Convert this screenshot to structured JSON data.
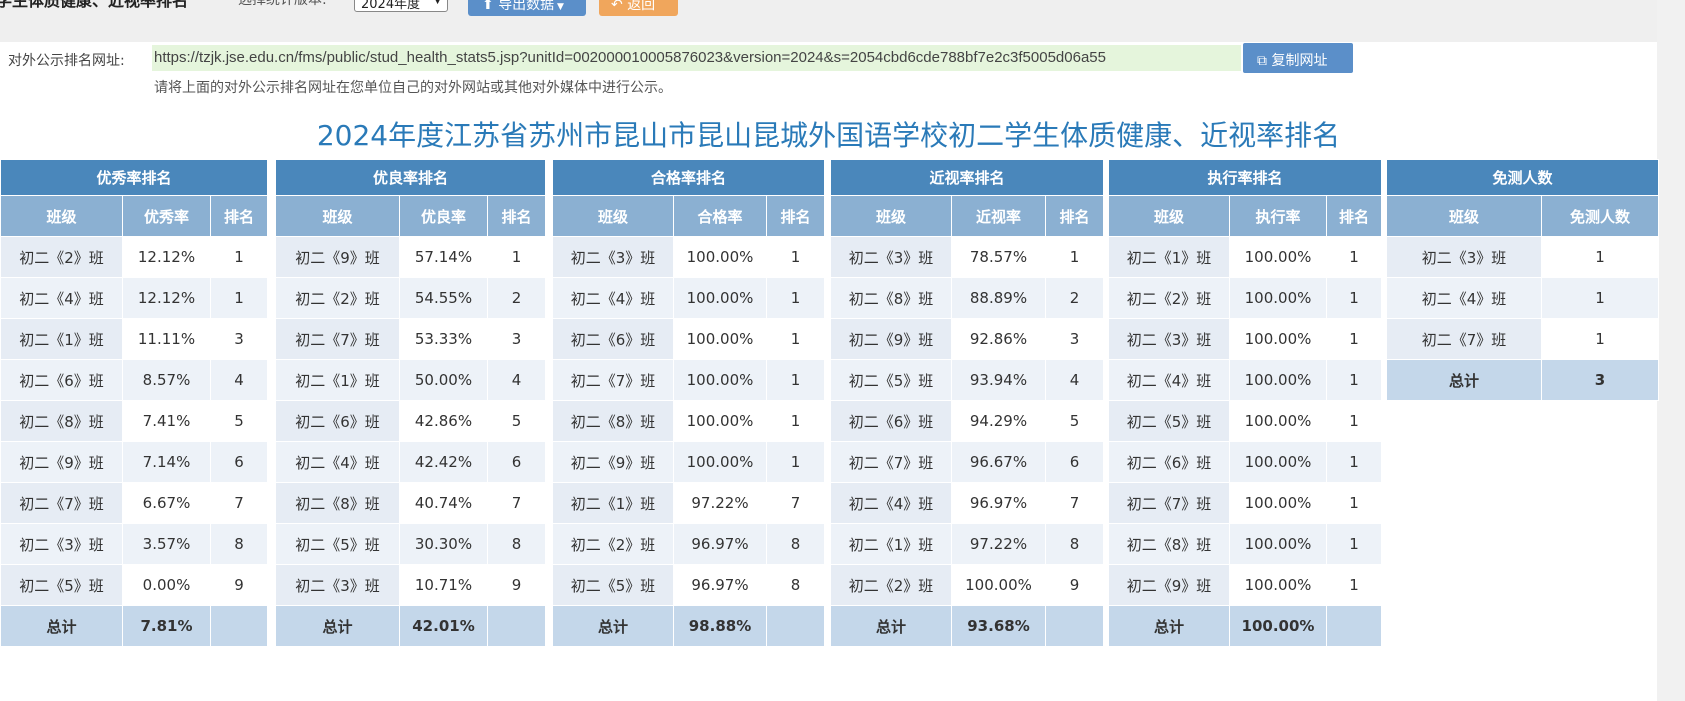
{
  "header": {
    "title": "学生体质健康、近视率排名",
    "version_label": "选择统计版本:",
    "version_value": "2024年度",
    "export_button": "导出数据",
    "back_button": "返回"
  },
  "public_url": {
    "label": "对外公示排名网址:",
    "value": "https://tzjk.jse.edu.cn/fms/public/stud_health_stats5.jsp?unitId=00200001000587602​3&version=2024&s=2054cbd6cde788bf7e2c3f5005d06a55",
    "copy_button": "复制网址",
    "hint": "请将上面的对外公示排名网址在您单位自己的对外网站或其他对外媒体中进行公示。"
  },
  "page_title": "2024年度江苏省苏州市昆山市昆山昆城外国语学校初二学生体质健康、近视率排名",
  "tables": [
    {
      "title": "优秀率排名",
      "headers": [
        "班级",
        "优秀率",
        "排名"
      ],
      "rows": [
        [
          "初二《2》班",
          "12.12%",
          "1"
        ],
        [
          "初二《4》班",
          "12.12%",
          "1"
        ],
        [
          "初二《1》班",
          "11.11%",
          "3"
        ],
        [
          "初二《6》班",
          "8.57%",
          "4"
        ],
        [
          "初二《8》班",
          "7.41%",
          "5"
        ],
        [
          "初二《9》班",
          "7.14%",
          "6"
        ],
        [
          "初二《7》班",
          "6.67%",
          "7"
        ],
        [
          "初二《3》班",
          "3.57%",
          "8"
        ],
        [
          "初二《5》班",
          "0.00%",
          "9"
        ]
      ],
      "total": [
        "总计",
        "7.81%",
        ""
      ]
    },
    {
      "title": "优良率排名",
      "headers": [
        "班级",
        "优良率",
        "排名"
      ],
      "rows": [
        [
          "初二《9》班",
          "57.14%",
          "1"
        ],
        [
          "初二《2》班",
          "54.55%",
          "2"
        ],
        [
          "初二《7》班",
          "53.33%",
          "3"
        ],
        [
          "初二《1》班",
          "50.00%",
          "4"
        ],
        [
          "初二《6》班",
          "42.86%",
          "5"
        ],
        [
          "初二《4》班",
          "42.42%",
          "6"
        ],
        [
          "初二《8》班",
          "40.74%",
          "7"
        ],
        [
          "初二《5》班",
          "30.30%",
          "8"
        ],
        [
          "初二《3》班",
          "10.71%",
          "9"
        ]
      ],
      "total": [
        "总计",
        "42.01%",
        ""
      ]
    },
    {
      "title": "合格率排名",
      "headers": [
        "班级",
        "合格率",
        "排名"
      ],
      "rows": [
        [
          "初二《3》班",
          "100.00%",
          "1"
        ],
        [
          "初二《4》班",
          "100.00%",
          "1"
        ],
        [
          "初二《6》班",
          "100.00%",
          "1"
        ],
        [
          "初二《7》班",
          "100.00%",
          "1"
        ],
        [
          "初二《8》班",
          "100.00%",
          "1"
        ],
        [
          "初二《9》班",
          "100.00%",
          "1"
        ],
        [
          "初二《1》班",
          "97.22%",
          "7"
        ],
        [
          "初二《2》班",
          "96.97%",
          "8"
        ],
        [
          "初二《5》班",
          "96.97%",
          "8"
        ]
      ],
      "total": [
        "总计",
        "98.88%",
        ""
      ]
    },
    {
      "title": "近视率排名",
      "headers": [
        "班级",
        "近视率",
        "排名"
      ],
      "rows": [
        [
          "初二《3》班",
          "78.57%",
          "1"
        ],
        [
          "初二《8》班",
          "88.89%",
          "2"
        ],
        [
          "初二《9》班",
          "92.86%",
          "3"
        ],
        [
          "初二《5》班",
          "93.94%",
          "4"
        ],
        [
          "初二《6》班",
          "94.29%",
          "5"
        ],
        [
          "初二《7》班",
          "96.67%",
          "6"
        ],
        [
          "初二《4》班",
          "96.97%",
          "7"
        ],
        [
          "初二《1》班",
          "97.22%",
          "8"
        ],
        [
          "初二《2》班",
          "100.00%",
          "9"
        ]
      ],
      "total": [
        "总计",
        "93.68%",
        ""
      ]
    },
    {
      "title": "执行率排名",
      "headers": [
        "班级",
        "执行率",
        "排名"
      ],
      "rows": [
        [
          "初二《1》班",
          "100.00%",
          "1"
        ],
        [
          "初二《2》班",
          "100.00%",
          "1"
        ],
        [
          "初二《3》班",
          "100.00%",
          "1"
        ],
        [
          "初二《4》班",
          "100.00%",
          "1"
        ],
        [
          "初二《5》班",
          "100.00%",
          "1"
        ],
        [
          "初二《6》班",
          "100.00%",
          "1"
        ],
        [
          "初二《7》班",
          "100.00%",
          "1"
        ],
        [
          "初二《8》班",
          "100.00%",
          "1"
        ],
        [
          "初二《9》班",
          "100.00%",
          "1"
        ]
      ],
      "total": [
        "总计",
        "100.00%",
        ""
      ]
    },
    {
      "title": "免测人数",
      "headers": [
        "班级",
        "免测人数"
      ],
      "rows": [
        [
          "初二《3》班",
          "1"
        ],
        [
          "初二《4》班",
          "1"
        ],
        [
          "初二《7》班",
          "1"
        ]
      ],
      "total": [
        "总计",
        "3"
      ]
    }
  ],
  "colors": {
    "table_title_bg": "#4a87bb",
    "column_header_bg": "#8bb0d2",
    "total_row_bg": "#c4d7ea",
    "page_title": "#2a7ab8",
    "url_highlight": "#e5f5dc",
    "export_button": "#5b8fc9",
    "back_button": "#f0a65c"
  }
}
